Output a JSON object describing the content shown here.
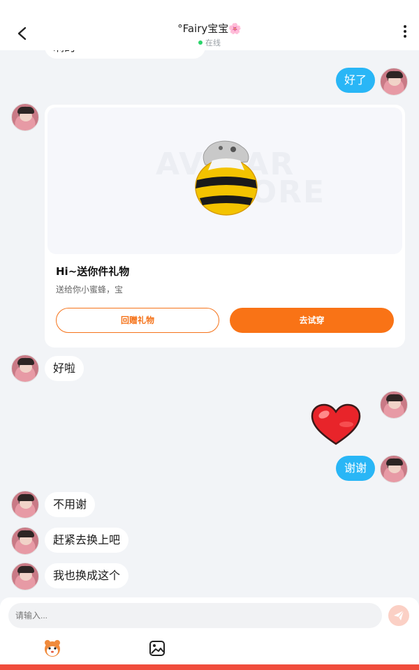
{
  "header": {
    "title": "°Fairy宝宝",
    "title_emoji": "🌸",
    "status": "在线"
  },
  "messages": {
    "top_partial": "瞒的",
    "m1": "好了",
    "gift": {
      "watermark_line1": "AVATAR",
      "watermark_line2": "STORE",
      "title": "Hi~送你件礼物",
      "subtitle": "送给你小蜜蜂，宝",
      "return_button": "回赠礼物",
      "try_button": "去试穿"
    },
    "m2": "好啦",
    "m3": "谢谢",
    "m4": "不用谢",
    "m5": "赶紧去换上吧",
    "m6": "我也换成这个"
  },
  "input": {
    "placeholder": "请输入..."
  },
  "colors": {
    "accent_orange": "#f97316",
    "bubble_blue": "#29b6f6",
    "online_green": "#2bd46a"
  },
  "icons": {
    "back": "back-arrow-icon",
    "more": "more-vertical-icon",
    "send": "send-icon",
    "mascot": "mascot-icon",
    "image": "image-icon",
    "heart": "heart-sticker"
  }
}
